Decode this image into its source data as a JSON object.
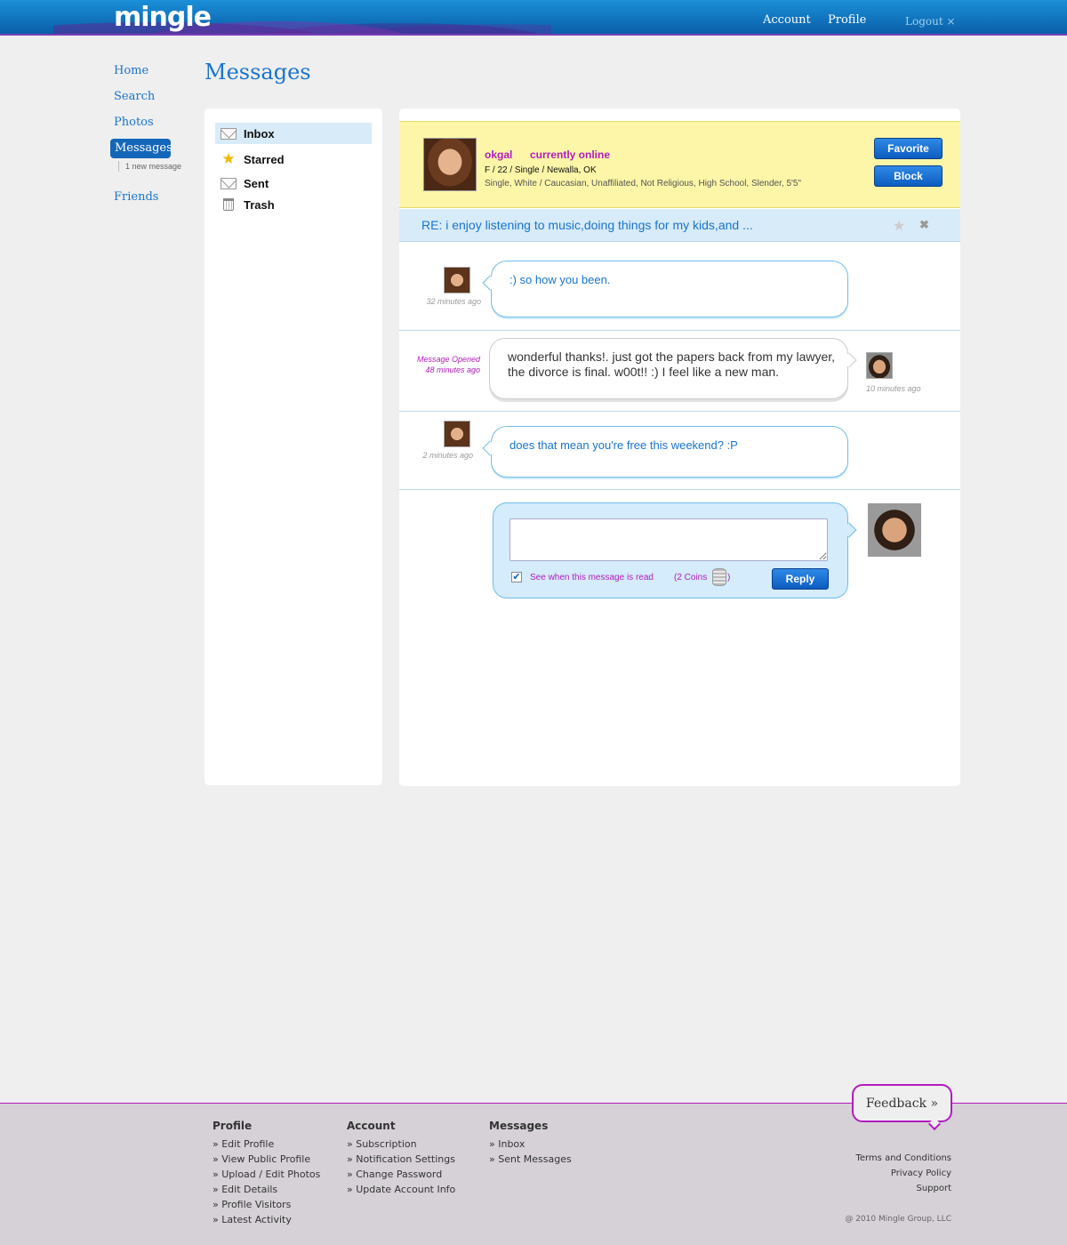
{
  "header": {
    "logo": "mingle",
    "nav": [
      "Account",
      "Profile"
    ],
    "logout": "Logout ×"
  },
  "sidebar": {
    "items": [
      {
        "label": "Home"
      },
      {
        "label": "Search"
      },
      {
        "label": "Photos"
      },
      {
        "label": "Messages",
        "active": true
      },
      {
        "label": "Friends"
      }
    ],
    "new_message": "1 new message"
  },
  "page_title": "Messages",
  "folders": [
    {
      "label": "Inbox",
      "icon": "envelope-icon",
      "active": true
    },
    {
      "label": "Starred",
      "icon": "star-icon"
    },
    {
      "label": "Sent",
      "icon": "envelope-icon"
    },
    {
      "label": "Trash",
      "icon": "trash-icon"
    }
  ],
  "profile": {
    "username": "okgal",
    "status": "currently online",
    "basic": "F / 22 / Single / Newalla, OK",
    "details": "Single, White / Caucasian, Unaffiliated, Not Religious, High School, Slender, 5'5\"",
    "favorite_label": "Favorite",
    "block_label": "Block"
  },
  "subject": "RE: i enjoy listening to music,doing things for my kids,and ...",
  "messages": [
    {
      "from": "them",
      "text": ":) so how you been.",
      "time": "32 minutes ago"
    },
    {
      "from": "me",
      "text": "wonderful thanks!. just got the papers back from my lawyer, the divorce is final. w00t!! :) I feel like a new man.",
      "time": "10 minutes ago",
      "opened": "Message Opened",
      "opened_time": "48 minutes ago"
    },
    {
      "from": "them",
      "text": "does that mean you're free this weekend? :P",
      "time": "2 minutes ago"
    }
  ],
  "reply": {
    "input_value": "",
    "read_receipt_label": "See when this message is read",
    "coins_label": "(2 Coins",
    "coins_close": ")",
    "read_receipt_checked": true,
    "button_label": "Reply"
  },
  "footer": {
    "columns": [
      {
        "title": "Profile",
        "links": [
          "» Edit Profile",
          "» View Public Profile",
          "» Upload / Edit Photos",
          "» Edit Details",
          "» Profile Visitors",
          "» Latest Activity"
        ]
      },
      {
        "title": "Account",
        "links": [
          "» Subscription",
          "» Notification Settings",
          "» Change Password",
          "» Update Account Info"
        ]
      },
      {
        "title": "Messages",
        "links": [
          "» Inbox",
          "» Sent Messages"
        ]
      }
    ],
    "feedback": "Feedback »",
    "links": [
      "Terms and Conditions",
      "Privacy Policy",
      "Support"
    ],
    "copyright": "@ 2010 Mingle Group, LLC"
  },
  "colors": {
    "accent_blue": "#1874cd",
    "accent_purple": "#b21cbe",
    "profile_bg": "#fdf6a8"
  }
}
